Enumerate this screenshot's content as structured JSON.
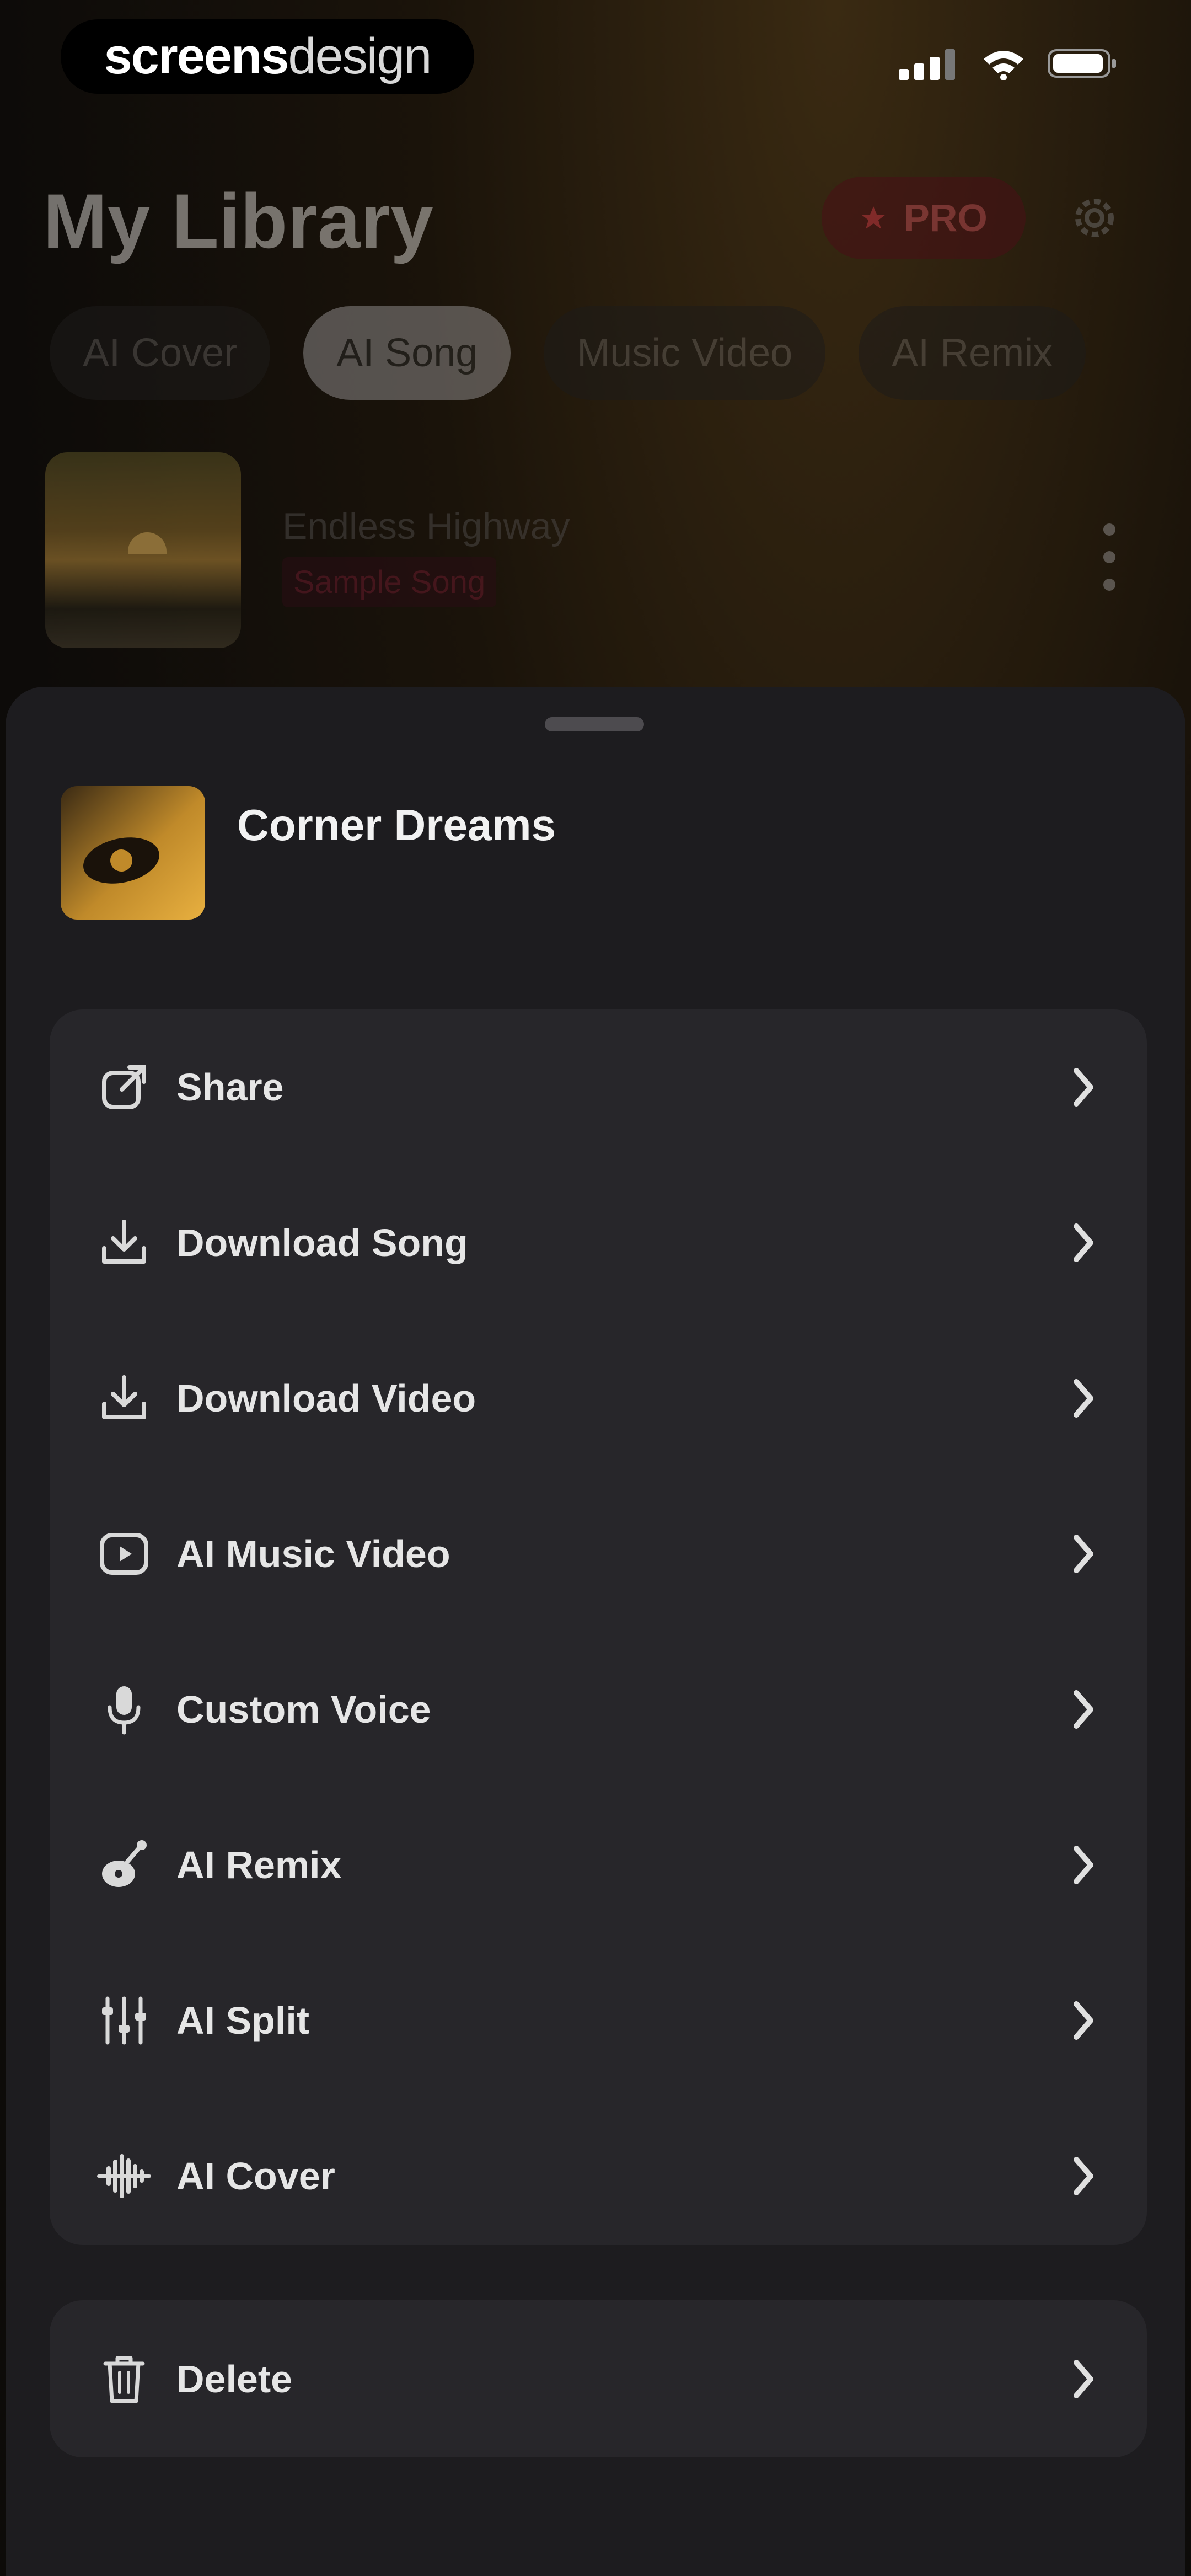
{
  "status_bar": {
    "brand_bold": "screens",
    "brand_light": "design"
  },
  "library": {
    "title": "My Library",
    "pro_label": "PRO",
    "tabs": [
      {
        "label": "AI Cover",
        "active": false
      },
      {
        "label": "AI Song",
        "active": true
      },
      {
        "label": "Music Video",
        "active": false
      },
      {
        "label": "AI Remix",
        "active": false
      }
    ],
    "song": {
      "title": "Endless Highway",
      "tag": "Sample Song"
    }
  },
  "sheet": {
    "song_title": "Corner Dreams",
    "menu_items": [
      {
        "label": "Share",
        "icon": "share-icon"
      },
      {
        "label": "Download Song",
        "icon": "download-icon"
      },
      {
        "label": "Download Video",
        "icon": "download-icon"
      },
      {
        "label": "AI Music Video",
        "icon": "video-play-icon"
      },
      {
        "label": "Custom Voice",
        "icon": "microphone-icon"
      },
      {
        "label": "AI Remix",
        "icon": "remix-icon"
      },
      {
        "label": "AI Split",
        "icon": "split-sliders-icon"
      },
      {
        "label": "AI Cover",
        "icon": "waveform-icon"
      }
    ],
    "delete_label": "Delete"
  },
  "colors": {
    "sheet_bg": "#1d1c1f",
    "card_bg": "#27262a",
    "accent_pro": "#b5464f"
  }
}
